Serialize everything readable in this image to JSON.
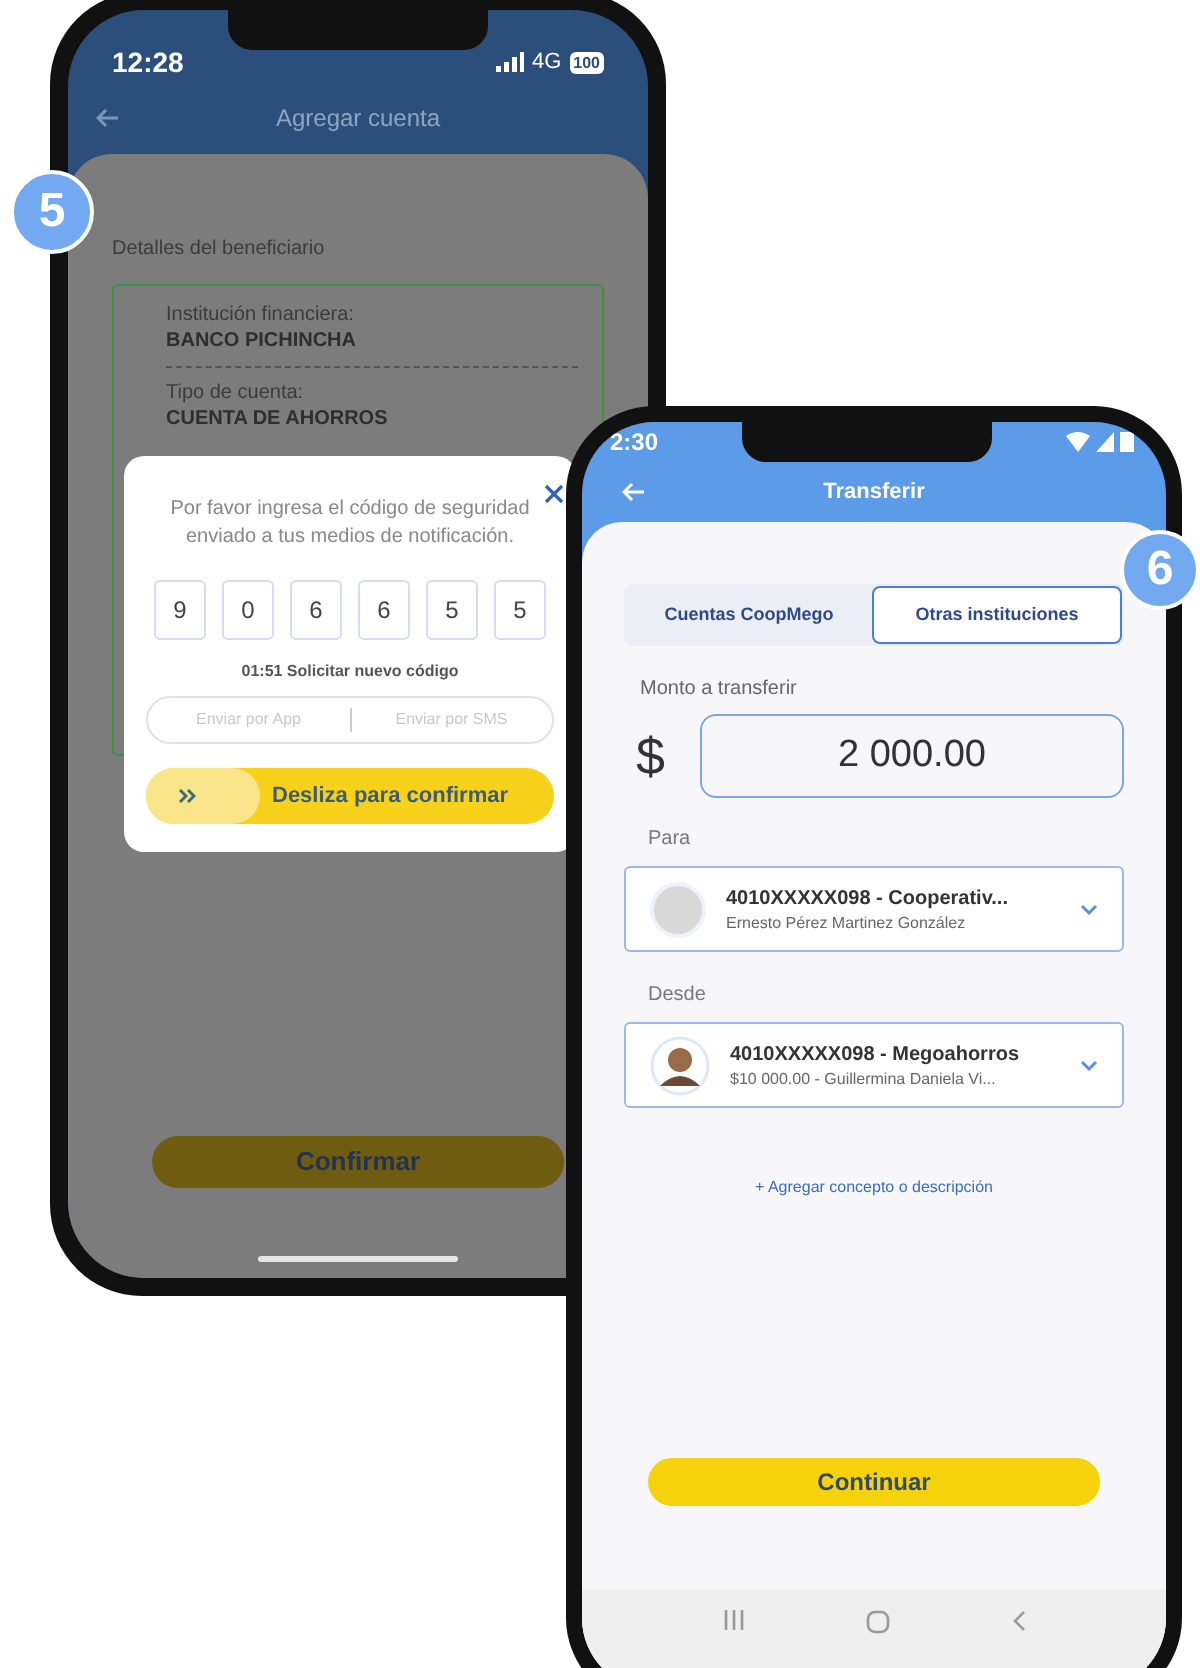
{
  "screens": [
    {
      "step": "5",
      "status_bar": {
        "time": "12:28",
        "network": "4G",
        "battery": "100"
      },
      "header": {
        "title": "Agregar cuenta"
      },
      "section_label": "Detalles del beneficiario",
      "details": [
        {
          "label": "Institución financiera:",
          "value": "BANCO PICHINCHA"
        },
        {
          "label": "Tipo de cuenta:",
          "value": "CUENTA DE AHORROS"
        }
      ],
      "modal": {
        "message": "Por favor ingresa el código de seguridad enviado a tus medios de notificación.",
        "code_digits": [
          "9",
          "0",
          "6",
          "6",
          "5",
          "5"
        ],
        "timer": "01:51 Solicitar nuevo código",
        "send_options": [
          {
            "label": "Enviar por App",
            "selected": false
          },
          {
            "label": "Enviar por SMS",
            "selected": false
          }
        ],
        "slider": {
          "label": "Desliza para confirmar",
          "level": 0.28
        }
      },
      "confirm_button": "Confirmar"
    },
    {
      "step": "6",
      "status_bar": {
        "time": "2:30"
      },
      "header": {
        "title": "Transferir"
      },
      "tabs": [
        {
          "label": "Cuentas CoopMego",
          "selected": false
        },
        {
          "label": "Otras instituciones",
          "selected": true
        }
      ],
      "amount": {
        "label": "Monto a transferir",
        "currency": "$",
        "value": "2 000.00"
      },
      "accounts": [
        {
          "label": "Para",
          "account": "4010XXXXX098 - Cooperativ...",
          "detail": "Ernesto Pérez Martinez González",
          "kind": "blank"
        },
        {
          "label": "Desde",
          "account": "4010XXXXX098 - Megoahorros",
          "detail": "$10 000.00 - Guillermina Daniela Vi...",
          "kind": "picture"
        }
      ],
      "add_link": "+ Agregar concepto o descripción",
      "continue_button": "Continuar"
    }
  ]
}
